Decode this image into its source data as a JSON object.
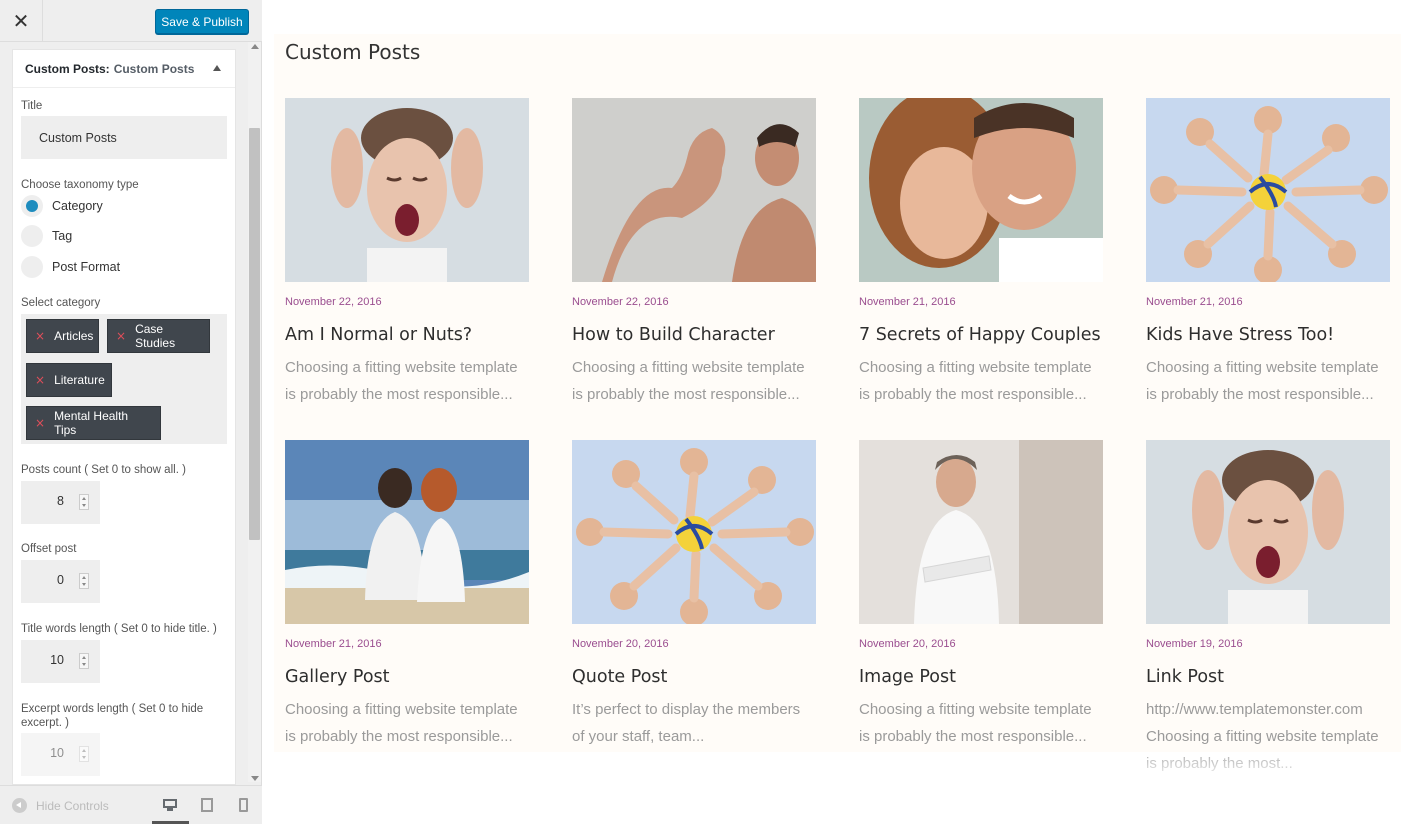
{
  "toolbar": {
    "close_glyph": "✕",
    "publish_label": "Save & Publish"
  },
  "widget": {
    "heading_bold": "Custom Posts:",
    "heading_name": "Custom Posts",
    "title_label": "Title",
    "title_value": "Custom Posts",
    "taxonomy_label": "Choose taxonomy type",
    "taxonomy_options": [
      {
        "label": "Category",
        "selected": true
      },
      {
        "label": "Tag",
        "selected": false
      },
      {
        "label": "Post Format",
        "selected": false
      }
    ],
    "category_label": "Select category",
    "category_tags": [
      "Articles",
      "Case Studies",
      "Literature",
      "Mental Health Tips"
    ],
    "tag_remove_glyph": "×",
    "posts_count_label": "Posts count ( Set 0 to show all. )",
    "posts_count_value": "8",
    "offset_label": "Offset post",
    "offset_value": "0",
    "title_words_label": "Title words length ( Set 0 to hide title. )",
    "title_words_value": "10",
    "excerpt_words_label": "Excerpt words length ( Set 0 to hide excerpt. )",
    "excerpt_words_value": "10"
  },
  "footer": {
    "hide_controls_label": "Hide Controls",
    "devices": [
      "desktop-icon",
      "tablet-icon",
      "mobile-icon"
    ]
  },
  "preview": {
    "section_title": "Custom Posts",
    "posts": [
      {
        "date": "November 22, 2016",
        "title": "Am I Normal or Nuts?",
        "excerpt": "Choosing a fitting website template is probably the most responsible...",
        "image": "screaming-woman"
      },
      {
        "date": "November 22, 2016",
        "title": "How to Build Character",
        "excerpt": "Choosing a fitting website template is probably the most responsible...",
        "image": "flexing-man"
      },
      {
        "date": "November 21, 2016",
        "title": "7 Secrets of Happy Couples",
        "excerpt": "Choosing a fitting website template is probably the most responsible...",
        "image": "happy-couple"
      },
      {
        "date": "November 21, 2016",
        "title": "Kids Have Stress Too!",
        "excerpt": "Choosing a fitting website template is probably the most responsible...",
        "image": "kids-circle-volleyball"
      },
      {
        "date": "November 21, 2016",
        "title": "Gallery Post",
        "excerpt": "Choosing a fitting website template is probably the most responsible...",
        "image": "couple-beach"
      },
      {
        "date": "November 20, 2016",
        "title": "Quote Post",
        "excerpt": "It’s perfect to display the members of your staff, team...",
        "image": "kids-circle-volleyball"
      },
      {
        "date": "November 20, 2016",
        "title": "Image Post",
        "excerpt": "Choosing a fitting website template is probably the most responsible...",
        "image": "businessman"
      },
      {
        "date": "November 19, 2016",
        "title": "Link Post",
        "excerpt": "http://www.templatemonster.com Choosing a fitting website template is probably the most...",
        "image": "screaming-woman"
      }
    ],
    "colors": {
      "date": "#9a4d8f",
      "publish": "#0085ba",
      "tag_bg": "#40464d",
      "radio_on": "#1e8cbe"
    }
  }
}
